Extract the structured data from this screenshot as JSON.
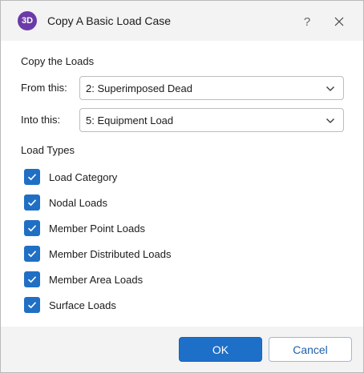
{
  "window": {
    "app_icon_text": "3D",
    "title": "Copy A Basic Load Case",
    "help_label": "?",
    "app_icon_color": "#6b3aa8"
  },
  "copy_loads": {
    "section_title": "Copy the Loads",
    "from_label": "From this:",
    "from_value": "2: Superimposed Dead",
    "into_label": "Into this:",
    "into_value": "5: Equipment Load"
  },
  "load_types": {
    "section_title": "Load Types",
    "items": [
      {
        "label": "Load Category",
        "checked": true
      },
      {
        "label": "Nodal Loads",
        "checked": true
      },
      {
        "label": "Member Point Loads",
        "checked": true
      },
      {
        "label": "Member Distributed Loads",
        "checked": true
      },
      {
        "label": "Member Area Loads",
        "checked": true
      },
      {
        "label": "Surface Loads",
        "checked": true
      }
    ]
  },
  "footer": {
    "ok_label": "OK",
    "cancel_label": "Cancel"
  },
  "colors": {
    "accent": "#1e6fc8",
    "checkbox": "#1f6fc5"
  },
  "icons": {
    "close": "close-icon",
    "help": "help-icon",
    "chevron": "chevron-down-icon",
    "check": "checkmark-icon"
  }
}
